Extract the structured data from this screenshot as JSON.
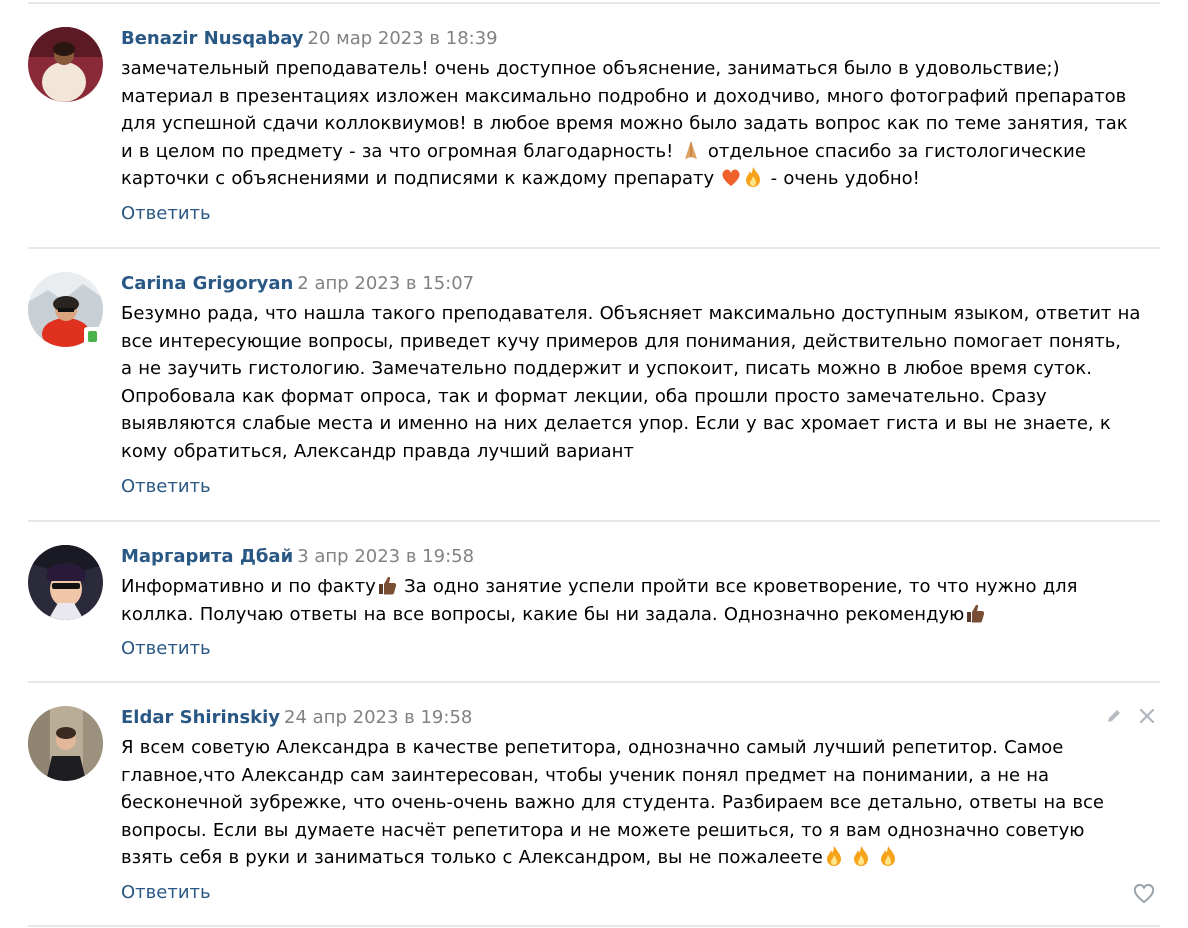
{
  "reply_label": "Ответить",
  "colors": {
    "author_link": "#2a5885",
    "date_gray": "#828282",
    "divider": "#e7e8ec",
    "online_green": "#4bb34b"
  },
  "comments": [
    {
      "author": "Benazir Nusqabay",
      "date": "20 мар 2023 в 18:39",
      "lines": [
        "замечательный преподаватель! очень доступное объяснение, заниматься было в удовольствие;)",
        "материал в презентациях изложен максимально подробно и доходчиво, много фотографий препаратов",
        "для успешной сдачи коллоквиумов! в любое время можно было задать вопрос как по теме занятия, так",
        "и в целом по предмету - за что огромная благодарность!",
        "отдельное спасибо за гистологические",
        "карточки с объяснениями и подписями к каждому препарату",
        "- очень удобно!"
      ]
    },
    {
      "author": "Carina Grigoryan",
      "date": "2 апр 2023 в 15:07",
      "lines": [
        "Безумно рада, что нашла такого преподавателя. Объясняет максимально доступным языком, ответит на",
        "все интересующие вопросы, приведет кучу примеров для понимания, действительно помогает понять,",
        "а не заучить гистологию. Замечательно поддержит и успокоит, писать можно в любое время суток.",
        "Опробовала как формат опроса, так и формат лекции, оба прошли просто замечательно. Сразу",
        "выявляются слабые места и именно на них делается упор. Если у вас хромает гиста и вы не знаете, к",
        "кому обратиться, Александр правда лучший вариант"
      ]
    },
    {
      "author": "Маргарита Дбай",
      "date": "3 апр 2023 в 19:58",
      "lines": [
        "Информативно и по факту",
        "За одно занятие успели пройти все кроветворение, то что нужно для",
        "коллка. Получаю ответы на все вопросы, какие бы ни задала. Однозначно рекомендую"
      ]
    },
    {
      "author": "Eldar Shirinskiy",
      "date": "24 апр 2023 в 19:58",
      "lines": [
        "Я всем советую Александра в качестве репетитора, однозначно самый лучший репетитор. Самое",
        "главное,что Александр сам заинтересован, чтобы ученик понял предмет на понимании, а не на",
        "бесконечной зубрежке, что очень-очень важно для студента. Разбираем все детально, ответы на все",
        "вопросы. Если вы думаете насчёт репетитора и не можете решиться, то я вам однозначно советую",
        "взять себя в руки и заниматься только с Александром, вы не пожалеете"
      ]
    }
  ]
}
